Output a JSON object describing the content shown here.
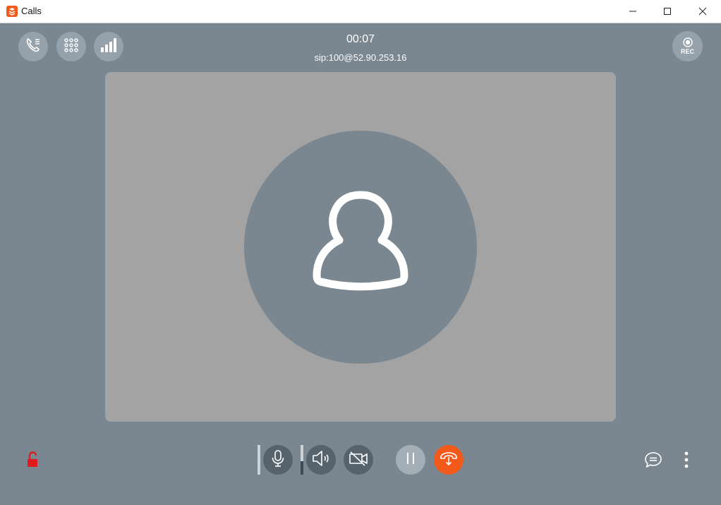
{
  "window": {
    "title": "Calls"
  },
  "call": {
    "timer": "00:07",
    "address": "sip:100@52.90.253.16"
  },
  "top_buttons": {
    "rec_label": "REC"
  },
  "levels": {
    "microphone_level": 0,
    "speaker_level": 0.45
  },
  "colors": {
    "accent": "#f25a1c",
    "background": "#7a8790",
    "video_area": "#a3a3a3",
    "lock": "#e11b1b"
  },
  "icons": {
    "call_history": "phone-list-icon",
    "dialpad": "dialpad-icon",
    "signal": "signal-strength-icon",
    "record": "record-icon",
    "lock": "unlocked-padlock-icon",
    "microphone": "microphone-icon",
    "speaker": "speaker-icon",
    "camera": "camera-off-icon",
    "hold": "pause-icon",
    "transfer": "call-transfer-icon",
    "chat": "chat-bubble-icon",
    "more": "vertical-dots-icon"
  }
}
